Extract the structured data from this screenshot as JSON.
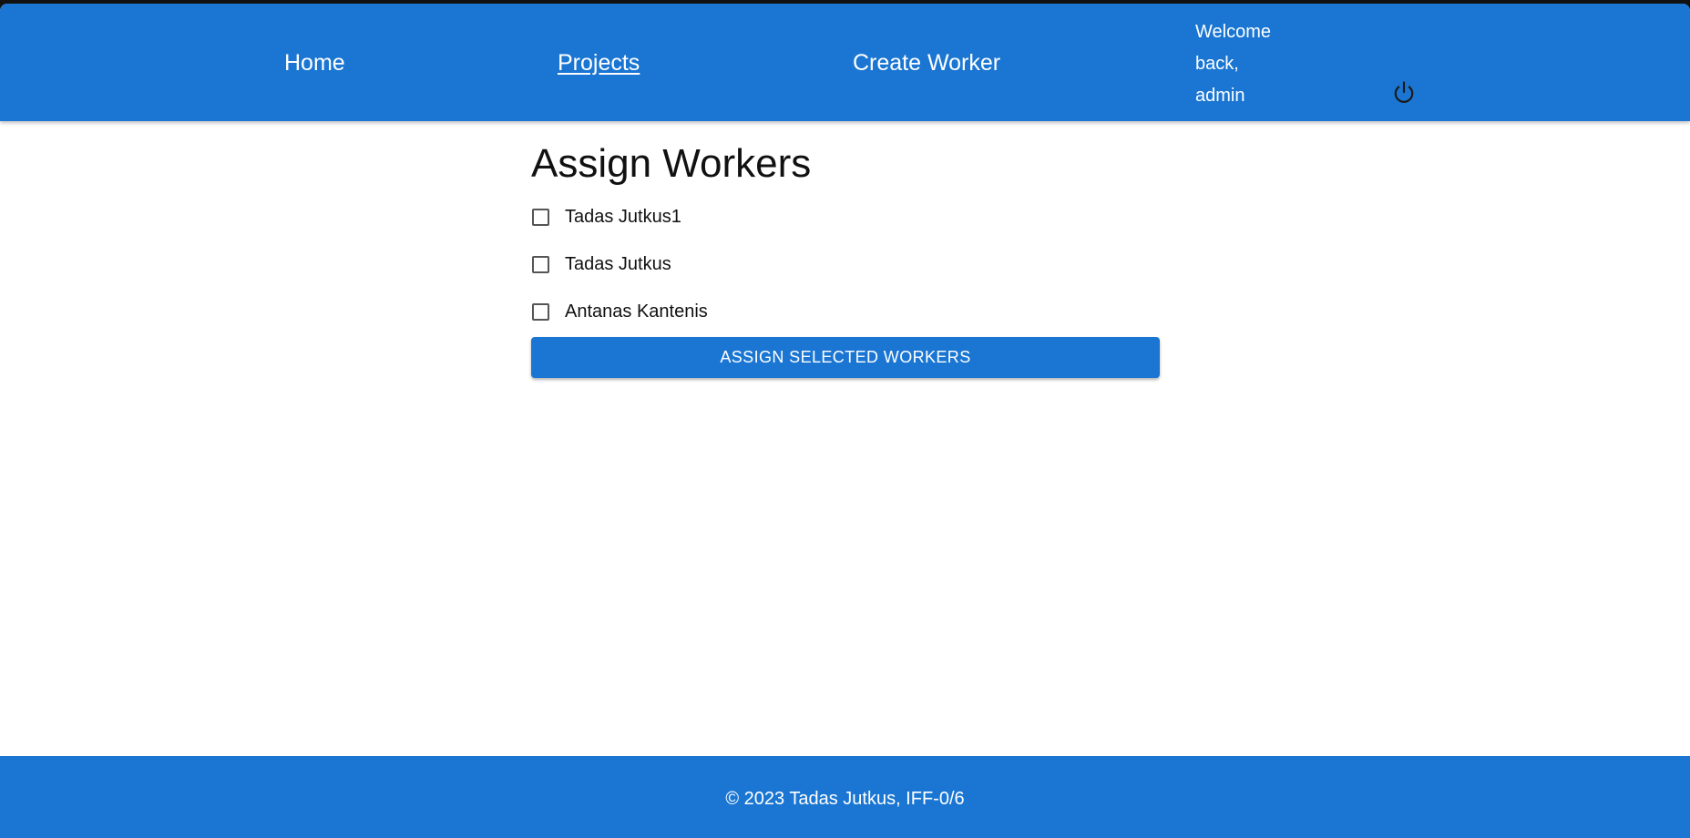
{
  "theme": {
    "accent": "#1a76d2",
    "text": "#111111",
    "background": "#ffffff"
  },
  "nav": {
    "links": [
      {
        "label": "Home",
        "active": false
      },
      {
        "label": "Projects",
        "active": true
      },
      {
        "label": "Create Worker",
        "active": false
      }
    ],
    "welcome": {
      "line1": "Welcome",
      "line2": "back,",
      "line3": "admin"
    },
    "logout_icon": "power-icon"
  },
  "main": {
    "title": "Assign Workers",
    "workers": [
      {
        "name": "Tadas Jutkus1",
        "checked": false
      },
      {
        "name": "Tadas Jutkus",
        "checked": false
      },
      {
        "name": "Antanas Kantenis",
        "checked": false
      }
    ],
    "assign_button": "ASSIGN SELECTED WORKERS"
  },
  "footer": {
    "text": "© 2023 Tadas Jutkus, IFF-0/6"
  }
}
